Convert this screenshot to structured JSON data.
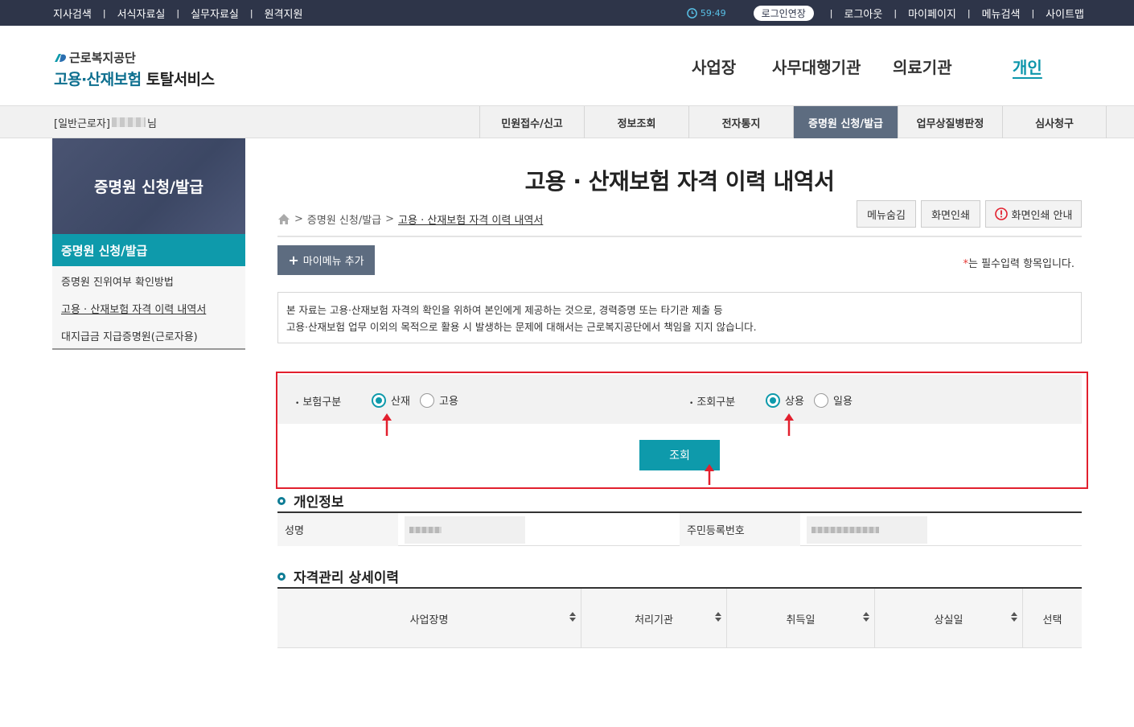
{
  "topbar": {
    "left_links": [
      "지사검색",
      "서식자료실",
      "실무자료실",
      "원격지원"
    ],
    "timer": "59:49",
    "extend_label": "로그인연장",
    "right_links": [
      "로그아웃",
      "마이페이지",
      "메뉴검색",
      "사이트맵"
    ]
  },
  "logo": {
    "org": "근로복지공단",
    "title_part1": "고용·산재보험",
    "title_part2": "토탈서비스"
  },
  "gnb": [
    "사업장",
    "사무대행기관",
    "의료기관",
    "개인"
  ],
  "subnav": {
    "user_prefix": "[일반근로자]",
    "user_suffix": "님",
    "tabs": [
      "민원접수/신고",
      "정보조회",
      "전자통지",
      "증명원 신청/발급",
      "업무상질병판정",
      "심사청구"
    ]
  },
  "lnb": {
    "heading": "증명원 신청/발급",
    "selected": "증명원 신청/발급",
    "items": [
      "증명원 진위여부 확인방법",
      "고용 · 산재보험 자격 이력 내역서",
      "대지급금 지급증명원(근로자용)"
    ]
  },
  "page": {
    "title": "고용 · 산재보험 자격 이력 내역서",
    "breadcrumb": [
      "증명원 신청/발급",
      "고용 · 산재보험 자격 이력 내역서"
    ],
    "util_buttons": [
      "메뉴숨김",
      "화면인쇄",
      "화면인쇄 안내"
    ],
    "mymenu_label": "마이메뉴 추가",
    "required_note": "는 필수입력 항목입니다.",
    "notice_lines": [
      "본 자료는 고용·산재보험 자격의 확인을 위하여 본인에게 제공하는 것으로, 경력증명 또는 타기관 제출 등",
      "고용·산재보험 업무 이외의 목적으로 활용 시 발생하는 문제에 대해서는 근로복지공단에서 책임을 지지 않습니다."
    ]
  },
  "search": {
    "insurance_label": "보험구분",
    "insurance_options": [
      "산재",
      "고용"
    ],
    "insurance_selected": "산재",
    "query_label": "조회구분",
    "query_options": [
      "상용",
      "일용"
    ],
    "query_selected": "상용",
    "button": "조회"
  },
  "personal": {
    "title": "개인정보",
    "name_label": "성명",
    "rrn_label": "주민등록번호"
  },
  "history": {
    "title": "자격관리 상세이력",
    "columns": [
      "사업장명",
      "처리기관",
      "취득일",
      "상실일",
      "선택"
    ]
  },
  "colors": {
    "topbar": "#2e3549",
    "accent": "#0e9aab",
    "nav_active": "#5d6c80",
    "highlight": "#e2202e"
  }
}
